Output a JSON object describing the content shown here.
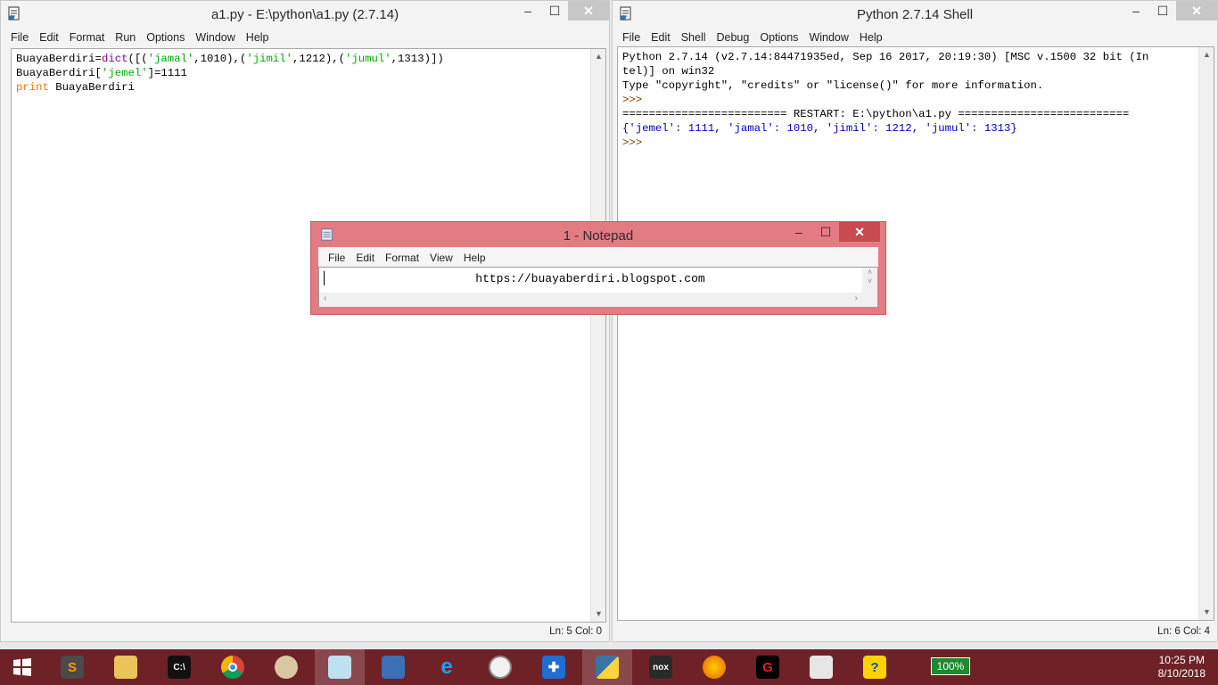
{
  "editor_window": {
    "title": "a1.py - E:\\python\\a1.py (2.7.14)",
    "menu": [
      "File",
      "Edit",
      "Format",
      "Run",
      "Options",
      "Window",
      "Help"
    ],
    "status": "Ln: 5   Col: 0"
  },
  "shell_window": {
    "title": "Python 2.7.14 Shell",
    "menu": [
      "File",
      "Edit",
      "Shell",
      "Debug",
      "Options",
      "Window",
      "Help"
    ],
    "lines": [
      "Python 2.7.14 (v2.7.14:84471935ed, Sep 16 2017, 20:19:30) [MSC v.1500 32 bit (In",
      "tel)] on win32",
      "Type \"copyright\", \"credits\" or \"license()\" for more information.",
      ">>> ",
      "========================= RESTART: E:\\python\\a1.py ==========================",
      "{'jemel': 1111, 'jamal': 1010, 'jimil': 1212, 'jumul': 1313}",
      ">>> "
    ],
    "status": "Ln: 6   Col: 4"
  },
  "notepad": {
    "title": "1 - Notepad",
    "menu": [
      "File",
      "Edit",
      "Format",
      "View",
      "Help"
    ],
    "content": "https://buayaberdiri.blogspot.com"
  },
  "taskbar": {
    "battery": "100%",
    "time": "10:25 PM",
    "date": "8/10/2018",
    "icons": [
      "windows-start-icon",
      "sublime-text-icon",
      "file-explorer-icon",
      "command-prompt-icon",
      "chrome-icon",
      "paint-icon",
      "notepad-icon",
      "remote-desktop-icon",
      "internet-explorer-icon",
      "clock-app-icon",
      "defender-icon",
      "python-icon",
      "nox-icon",
      "firefox-icon",
      "garena-icon",
      "system-monitor-icon",
      "help-icon"
    ]
  },
  "colors": {
    "keyword": "#ff7700",
    "builtin": "#900090",
    "string": "#00aa00",
    "output": "#0000c0",
    "taskbar": "#6e2228",
    "notepad_frame": "#e27c82"
  }
}
